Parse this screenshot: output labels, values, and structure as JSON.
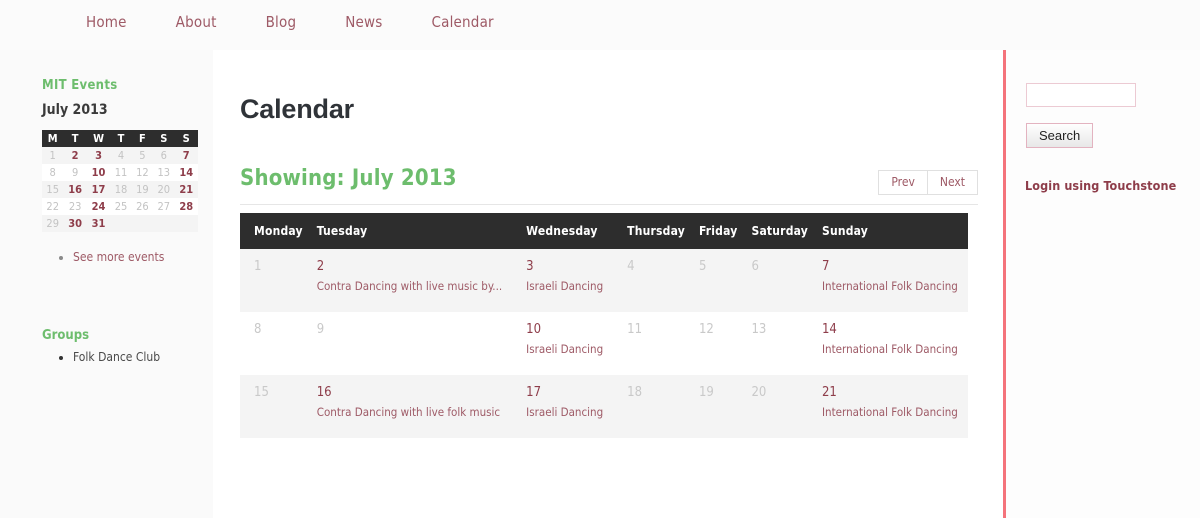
{
  "nav": {
    "items": [
      {
        "label": "Home"
      },
      {
        "label": "About"
      },
      {
        "label": "Blog"
      },
      {
        "label": "News"
      },
      {
        "label": "Calendar"
      }
    ]
  },
  "sidebar_left": {
    "events_widget_title": "MIT Events",
    "month_label": "July 2013",
    "weekday_initials": [
      "M",
      "T",
      "W",
      "T",
      "F",
      "S",
      "S"
    ],
    "mini_calendar_weeks": [
      [
        {
          "day": "1",
          "event": false
        },
        {
          "day": "2",
          "event": true
        },
        {
          "day": "3",
          "event": true
        },
        {
          "day": "4",
          "event": false
        },
        {
          "day": "5",
          "event": false
        },
        {
          "day": "6",
          "event": false
        },
        {
          "day": "7",
          "event": true
        }
      ],
      [
        {
          "day": "8",
          "event": false
        },
        {
          "day": "9",
          "event": false
        },
        {
          "day": "10",
          "event": true
        },
        {
          "day": "11",
          "event": false
        },
        {
          "day": "12",
          "event": false
        },
        {
          "day": "13",
          "event": false
        },
        {
          "day": "14",
          "event": true
        }
      ],
      [
        {
          "day": "15",
          "event": false
        },
        {
          "day": "16",
          "event": true
        },
        {
          "day": "17",
          "event": true
        },
        {
          "day": "18",
          "event": false
        },
        {
          "day": "19",
          "event": false
        },
        {
          "day": "20",
          "event": false
        },
        {
          "day": "21",
          "event": true
        }
      ],
      [
        {
          "day": "22",
          "event": false
        },
        {
          "day": "23",
          "event": false
        },
        {
          "day": "24",
          "event": true
        },
        {
          "day": "25",
          "event": false
        },
        {
          "day": "26",
          "event": false
        },
        {
          "day": "27",
          "event": false
        },
        {
          "day": "28",
          "event": true
        }
      ],
      [
        {
          "day": "29",
          "event": false
        },
        {
          "day": "30",
          "event": true
        },
        {
          "day": "31",
          "event": true
        },
        {
          "day": "",
          "event": false
        },
        {
          "day": "",
          "event": false
        },
        {
          "day": "",
          "event": false
        },
        {
          "day": "",
          "event": false
        }
      ]
    ],
    "see_more_label": "See more events",
    "groups_title": "Groups",
    "groups": [
      {
        "label": "Folk Dance Club"
      }
    ]
  },
  "main": {
    "page_title": "Calendar",
    "showing_label": "Showing: July 2013",
    "prev_label": "Prev",
    "next_label": "Next",
    "weekday_headers": [
      "Monday",
      "Tuesday",
      "Wednesday",
      "Thursday",
      "Friday",
      "Saturday",
      "Sunday"
    ],
    "weeks": [
      {
        "shaded": true,
        "days": [
          {
            "day": "1",
            "events": []
          },
          {
            "day": "2",
            "events": [
              "Contra Dancing with live music by..."
            ]
          },
          {
            "day": "3",
            "events": [
              "Israeli Dancing"
            ]
          },
          {
            "day": "4",
            "events": []
          },
          {
            "day": "5",
            "events": []
          },
          {
            "day": "6",
            "events": []
          },
          {
            "day": "7",
            "events": [
              "International Folk Dancing"
            ]
          }
        ]
      },
      {
        "shaded": false,
        "days": [
          {
            "day": "8",
            "events": []
          },
          {
            "day": "9",
            "events": []
          },
          {
            "day": "10",
            "events": [
              "Israeli Dancing"
            ]
          },
          {
            "day": "11",
            "events": []
          },
          {
            "day": "12",
            "events": []
          },
          {
            "day": "13",
            "events": []
          },
          {
            "day": "14",
            "events": [
              "International Folk Dancing"
            ]
          }
        ]
      },
      {
        "shaded": true,
        "days": [
          {
            "day": "15",
            "events": []
          },
          {
            "day": "16",
            "events": [
              "Contra Dancing with live folk music"
            ]
          },
          {
            "day": "17",
            "events": [
              "Israeli Dancing"
            ]
          },
          {
            "day": "18",
            "events": []
          },
          {
            "day": "19",
            "events": []
          },
          {
            "day": "20",
            "events": []
          },
          {
            "day": "21",
            "events": [
              "International Folk Dancing"
            ]
          }
        ]
      }
    ]
  },
  "sidebar_right": {
    "search_value": "",
    "search_placeholder": "",
    "search_button_label": "Search",
    "touchstone_label": "Login using Touchstone"
  },
  "colors": {
    "green": "#6dbd6d",
    "maroon": "#8e3d4a",
    "link": "#9e5a66",
    "header_dark": "#2d2d2d",
    "rule_red": "#f4737b",
    "row_shaded": "#f4f4f4"
  }
}
